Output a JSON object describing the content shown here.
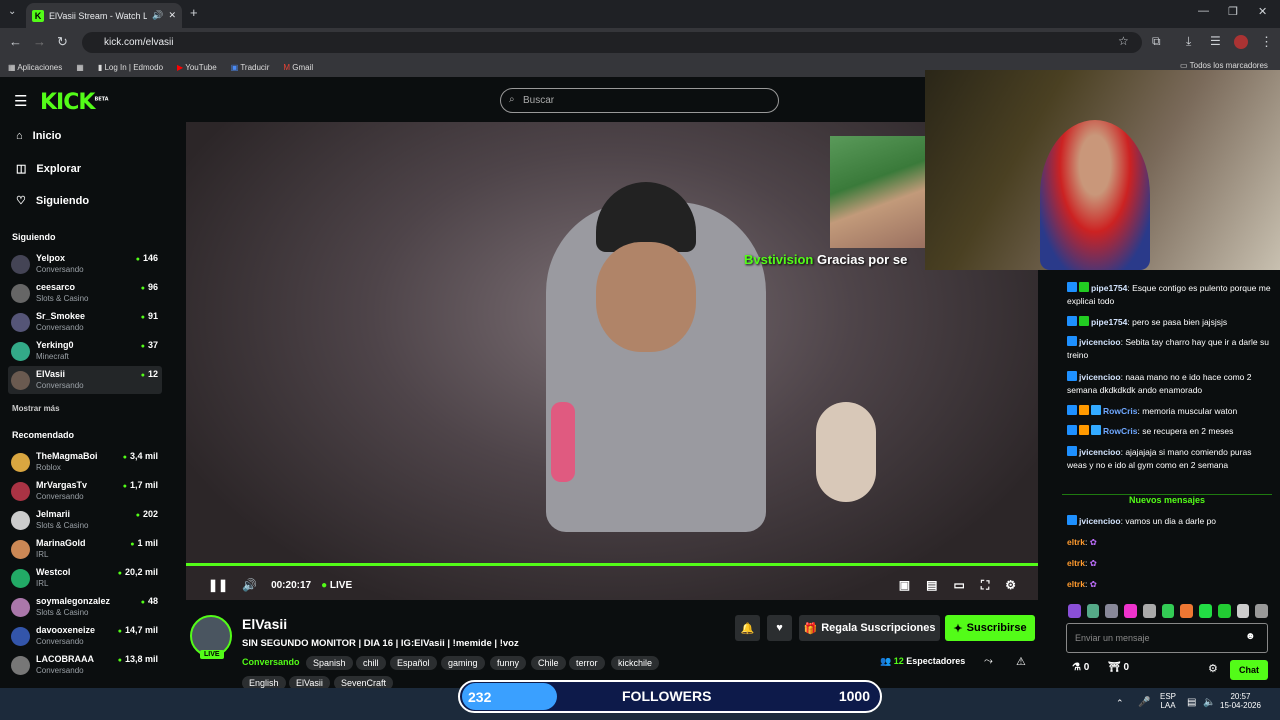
{
  "browser": {
    "tab_title": "ElVasii Stream - Watch Live",
    "url": "kick.com/elvasii",
    "bookmarks": [
      "Aplicaciones",
      "Log In | Edmodo",
      "YouTube",
      "Traducir",
      "Gmail"
    ],
    "all_bookmarks": "Todos los marcadores"
  },
  "kick": {
    "logo": "KICK",
    "logo_sup": "BETA",
    "search_placeholder": "Buscar",
    "nav": [
      "Inicio",
      "Explorar",
      "Siguiendo"
    ],
    "following_title": "Siguiendo",
    "following": [
      {
        "name": "Yelpox",
        "category": "Conversando",
        "viewers": "146"
      },
      {
        "name": "ceesarco",
        "category": "Slots & Casino",
        "viewers": "96"
      },
      {
        "name": "Sr_Smokee",
        "category": "Conversando",
        "viewers": "91"
      },
      {
        "name": "Yerking0",
        "category": "Minecraft",
        "viewers": "37"
      },
      {
        "name": "ElVasii",
        "category": "Conversando",
        "viewers": "12"
      }
    ],
    "show_more": "Mostrar más",
    "recommended_title": "Recomendado",
    "recommended": [
      {
        "name": "TheMagmaBoi",
        "category": "Roblox",
        "viewers": "3,4 mil"
      },
      {
        "name": "MrVargasTv",
        "category": "Conversando",
        "viewers": "1,7 mil"
      },
      {
        "name": "Jelmarii",
        "category": "Slots & Casino",
        "viewers": "202"
      },
      {
        "name": "MarinaGold",
        "category": "IRL",
        "viewers": "1 mil"
      },
      {
        "name": "Westcol",
        "category": "IRL",
        "viewers": "20,2 mil"
      },
      {
        "name": "soymalegonzalez",
        "category": "Slots & Casino",
        "viewers": "48"
      },
      {
        "name": "davooxeneize",
        "category": "Conversando",
        "viewers": "14,7 mil"
      },
      {
        "name": "LACOBRAAA",
        "category": "Conversando",
        "viewers": "13,8 mil"
      }
    ]
  },
  "player": {
    "time": "00:20:17",
    "live": "LIVE",
    "overlay_user": "Bvstivision",
    "overlay_text": "Gracias por se"
  },
  "stream": {
    "name": "ElVasii",
    "live_badge": "LIVE",
    "title": "SIN SEGUNDO MONITOR | DIA 16 | IG:ElVasii | !memide | !voz",
    "category": "Conversando",
    "tags_row1": [
      "Spanish",
      "chill",
      "Español",
      "gaming",
      "funny",
      "Chile",
      "terror",
      "kickchile"
    ],
    "tags_row2": [
      "English",
      "ElVasii",
      "SevenCraft"
    ],
    "gift_label": "Regala Suscripciones",
    "subscribe_label": "Suscribirse",
    "viewers_count": "12",
    "viewers_label": "Espectadores"
  },
  "chat": {
    "messages": [
      {
        "user": "pipe1754",
        "text": "Esque contigo es pulento porque me explicai todo",
        "color": "#d4e5ff"
      },
      {
        "user": "pipe1754",
        "text": "pero se pasa bien jajsjsjs",
        "color": "#d4e5ff"
      },
      {
        "user": "jvicencioo",
        "text": "Sebita tay charro hay que ir a darle su treino",
        "color": "#d4e5ff"
      },
      {
        "user": "jvicencioo",
        "text": "naaa mano no e ido hace como 2 semana dkdkdkdk ando enamorado",
        "color": "#d4e5ff"
      },
      {
        "user": "RowCris",
        "text": "memoria muscular waton",
        "color": "#6fa8ff"
      },
      {
        "user": "RowCris",
        "text": "se recupera en 2 meses",
        "color": "#6fa8ff"
      },
      {
        "user": "jvicencioo",
        "text": "ajajajaja si mano comiendo puras weas y no e ido al gym como en 2 semana",
        "color": "#d4e5ff"
      }
    ],
    "new_messages_label": "Nuevos mensajes",
    "new_messages": [
      {
        "user": "jvicencioo",
        "text": "vamos un dia a darle po",
        "color": "#d4e5ff"
      },
      {
        "user": "eltrk",
        "text": "",
        "color": "#ff9a2e"
      },
      {
        "user": "eltrk",
        "text": "",
        "color": "#ff9a2e"
      },
      {
        "user": "eltrk",
        "text": "",
        "color": "#ff9a2e"
      }
    ],
    "input_placeholder": "Enviar un mensaje",
    "points": "0",
    "gifts": "0",
    "send_label": "Chat"
  },
  "overlay_followers": {
    "current": "232",
    "label": "FOLLOWERS",
    "goal": "1000"
  },
  "taskbar": {
    "lang_top": "ESP",
    "lang_bottom": "LAA",
    "time": "20:57",
    "date": "15-04-2026"
  }
}
